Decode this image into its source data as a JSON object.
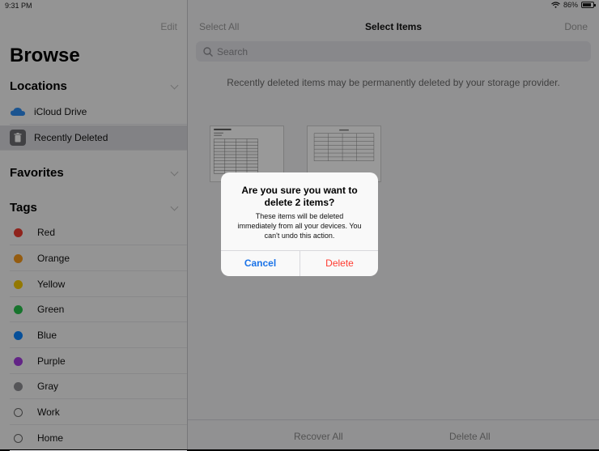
{
  "status": {
    "time": "9:31 PM",
    "battery": "86%",
    "battery_level": 0.86
  },
  "sidebar": {
    "edit_label": "Edit",
    "title": "Browse",
    "locations_header": "Locations",
    "locations": [
      {
        "label": "iCloud Drive",
        "icon": "icloud-icon"
      },
      {
        "label": "Recently Deleted",
        "icon": "trash-icon"
      }
    ],
    "favorites_header": "Favorites",
    "tags_header": "Tags",
    "tags": [
      {
        "label": "Red",
        "color": "#ef3b30"
      },
      {
        "label": "Orange",
        "color": "#f79a1b"
      },
      {
        "label": "Yellow",
        "color": "#f5c900"
      },
      {
        "label": "Green",
        "color": "#27c24c"
      },
      {
        "label": "Blue",
        "color": "#0a84ff"
      },
      {
        "label": "Purple",
        "color": "#a33de0"
      },
      {
        "label": "Gray",
        "color": "#8e8e93"
      },
      {
        "label": "Work",
        "color": ""
      },
      {
        "label": "Home",
        "color": ""
      }
    ]
  },
  "main": {
    "select_all": "Select All",
    "title": "Select Items",
    "done": "Done",
    "search_placeholder": "Search",
    "notice": "Recently deleted items may be permanently deleted by your storage provider.",
    "recover_all": "Recover All",
    "delete_all": "Delete All"
  },
  "alert": {
    "title_line1": "Are you sure you want to",
    "title_line2": "delete 2 items?",
    "msg_line1": "These items will be deleted",
    "msg_line2": "immediately from all your devices. You",
    "msg_line3": "can't undo this action.",
    "cancel": "Cancel",
    "delete": "Delete"
  },
  "colors": {
    "accent": "#1a73e8",
    "destructive": "#ff3b30"
  }
}
